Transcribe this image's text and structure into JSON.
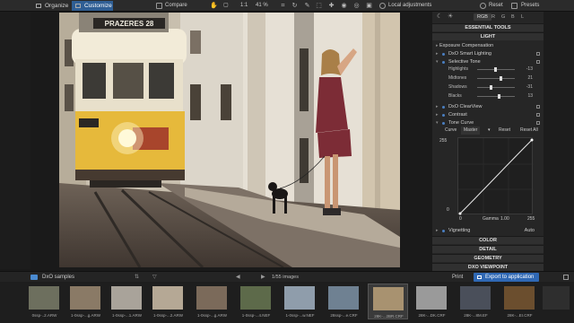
{
  "topbar": {
    "organize_label": "Organize",
    "customize_label": "Customize",
    "compare_label": "Compare",
    "zoom_fit": "▢",
    "zoom_11": "1:1",
    "zoom_pct": "41 %",
    "local_adjustments_label": "Local adjustments",
    "reset_label": "Reset",
    "presets_label": "Presets"
  },
  "photo": {
    "tram_sign": "PRAZERES 28"
  },
  "panel": {
    "channel_tabs": [
      "RGB",
      "R",
      "G",
      "B",
      "L"
    ],
    "essential_tools": "ESSENTIAL TOOLS",
    "light": "LIGHT",
    "exposure_compensation": "Exposure Compensation",
    "smart_lighting": "DxO Smart Lighting",
    "selective_tone": "Selective Tone",
    "sliders": [
      {
        "label": "Highlights",
        "value": "-13"
      },
      {
        "label": "Midtones",
        "value": "21"
      },
      {
        "label": "Shadows",
        "value": "-31"
      },
      {
        "label": "Blacks",
        "value": "13"
      }
    ],
    "clearview": "DxO ClearView",
    "contrast": "Contrast",
    "tone_curve": "Tone Curve",
    "curve_label": "Curve",
    "curve_channel": "Master",
    "curve_reset": "Reset",
    "curve_reset_all": "Reset All",
    "curve_top_value": "255",
    "curve_bottom_left": "0",
    "curve_out_low": "0",
    "gamma_label": "Gamma",
    "gamma_value": "1.00",
    "curve_out_high": "255",
    "vignetting": "Vignetting",
    "vignetting_value": "Auto",
    "color": "COLOR",
    "detail": "DETAIL",
    "geometry": "GEOMETRY",
    "viewpoint": "DXO VIEWPOINT"
  },
  "bottombar": {
    "folder_label": "DxO samples",
    "count_label": "1/55 images",
    "print_label": "Print",
    "export_label": "Export to application"
  },
  "filmstrip": [
    {
      "caption": "0ssp-..2.ARW",
      "color": "#6d6f5e"
    },
    {
      "caption": "1-0ssp-...g.ARW",
      "color": "#8a7a66"
    },
    {
      "caption": "1-0ssp-...1.ARW",
      "color": "#a9a39a"
    },
    {
      "caption": "1-0ssp-...2.ARW",
      "color": "#b5a895"
    },
    {
      "caption": "1-0ssp-...g.ARW",
      "color": "#7b6a5a"
    },
    {
      "caption": "1-0ssp-...4.NEF",
      "color": "#5d6a4a"
    },
    {
      "caption": "1-0ssp-...w.NEF",
      "color": "#8f9dab"
    },
    {
      "caption": "28ssp-...e.CRF",
      "color": "#6f8192"
    },
    {
      "caption": "28K-...2BR.CRF",
      "color": "#a89270"
    },
    {
      "caption": "28K-...DK.CRF",
      "color": "#9a9a9a"
    },
    {
      "caption": "28K-...8M.EF",
      "color": "#4a4f5a"
    },
    {
      "caption": "28K-...EI.CRF",
      "color": "#6b4e2e"
    },
    {
      "caption": "...",
      "color": "#2e2e2e"
    }
  ]
}
